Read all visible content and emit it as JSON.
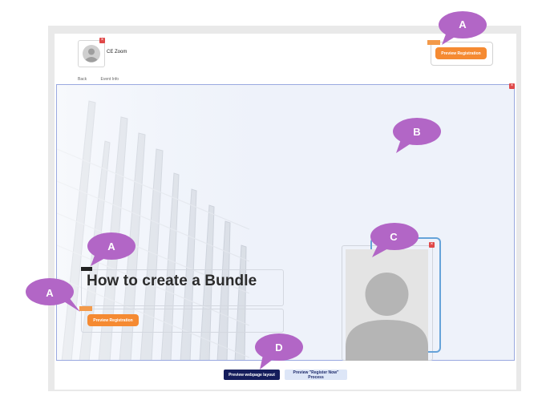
{
  "header": {
    "org_name": "CE Zoom",
    "preview_registration_label": "Preview Registration"
  },
  "nav": {
    "back": "Back",
    "event_info": "Event Info"
  },
  "hero": {
    "title": "How to create a Bundle",
    "preview_registration_label": "Preview Registration"
  },
  "footer": {
    "preview_layout_label": "Preview webpage layout",
    "preview_register_now_label": "Preview \"Register Now\" Process"
  },
  "callouts": {
    "a1": "A",
    "a2": "A",
    "a3": "A",
    "b": "B",
    "c": "C",
    "d": "D"
  },
  "colors": {
    "callout_purple": "#b266c6",
    "accent_orange": "#f58a32",
    "navy": "#151d5c",
    "close_red": "#e04848"
  },
  "icons": {
    "close": "close-icon",
    "avatar": "user-avatar-icon"
  }
}
